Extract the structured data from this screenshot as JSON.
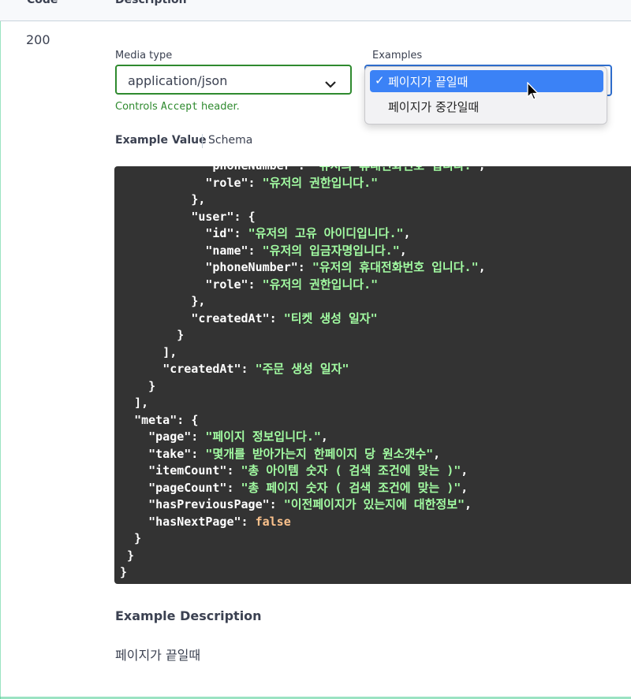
{
  "table_header": {
    "code": "Code",
    "description": "Description"
  },
  "response": {
    "status_code": "200",
    "media_type": {
      "label": "Media type",
      "selected": "application/json",
      "note_prefix": "Controls ",
      "note_code": "Accept",
      "note_suffix": " header."
    },
    "examples": {
      "label": "Examples",
      "options": [
        {
          "label": "페이지가 끝일때",
          "selected": true
        },
        {
          "label": "페이지가 중간일때",
          "selected": false
        }
      ],
      "check_glyph": "✓"
    },
    "tabs": {
      "example_value": "Example Value",
      "schema": "Schema"
    },
    "example_json_lines": [
      "          \"phoneNumber\": \"유저의 휴대전화번호 입니다.\",",
      "          \"role\": \"유저의 권한입니다.\"",
      "        },",
      "        \"user\": {",
      "          \"id\": \"유저의 고유 아이디입니다.\",",
      "          \"name\": \"유저의 입금자명입니다.\",",
      "          \"phoneNumber\": \"유저의 휴대전화번호 입니다.\",",
      "          \"role\": \"유저의 권한입니다.\"",
      "        },",
      "        \"createdAt\": \"티켓 생성 일자\"",
      "      }",
      "    ],",
      "    \"createdAt\": \"주문 생성 일자\"",
      "  }",
      "],",
      "\"meta\": {",
      "  \"page\": \"페이지 정보입니다.\",",
      "  \"take\": \"몇개를 받아가는지 한페이지 당 원소갯수\",",
      "  \"itemCount\": \"총 아이템 숫자 ( 검색 조건에 맞는 )\",",
      "  \"pageCount\": \"총 페이지 숫자 ( 검색 조건에 맞는 )\",",
      "  \"hasPreviousPage\": \"이전페이지가 있는지에 대한정보\",",
      "  \"hasNextPage\": false",
      "}",
      "}",
      "}"
    ],
    "example_description": {
      "title": "Example Description",
      "body": "페이지가 끝일때"
    }
  },
  "colors": {
    "accent_green": "#49cc90",
    "select_border_green": "#2f8a2f",
    "focus_blue": "#2f6fd0",
    "highlight_blue": "#3b82f6",
    "code_bg": "#333333",
    "code_string": "#a2fca2",
    "code_keyword": "#fcc28c"
  }
}
